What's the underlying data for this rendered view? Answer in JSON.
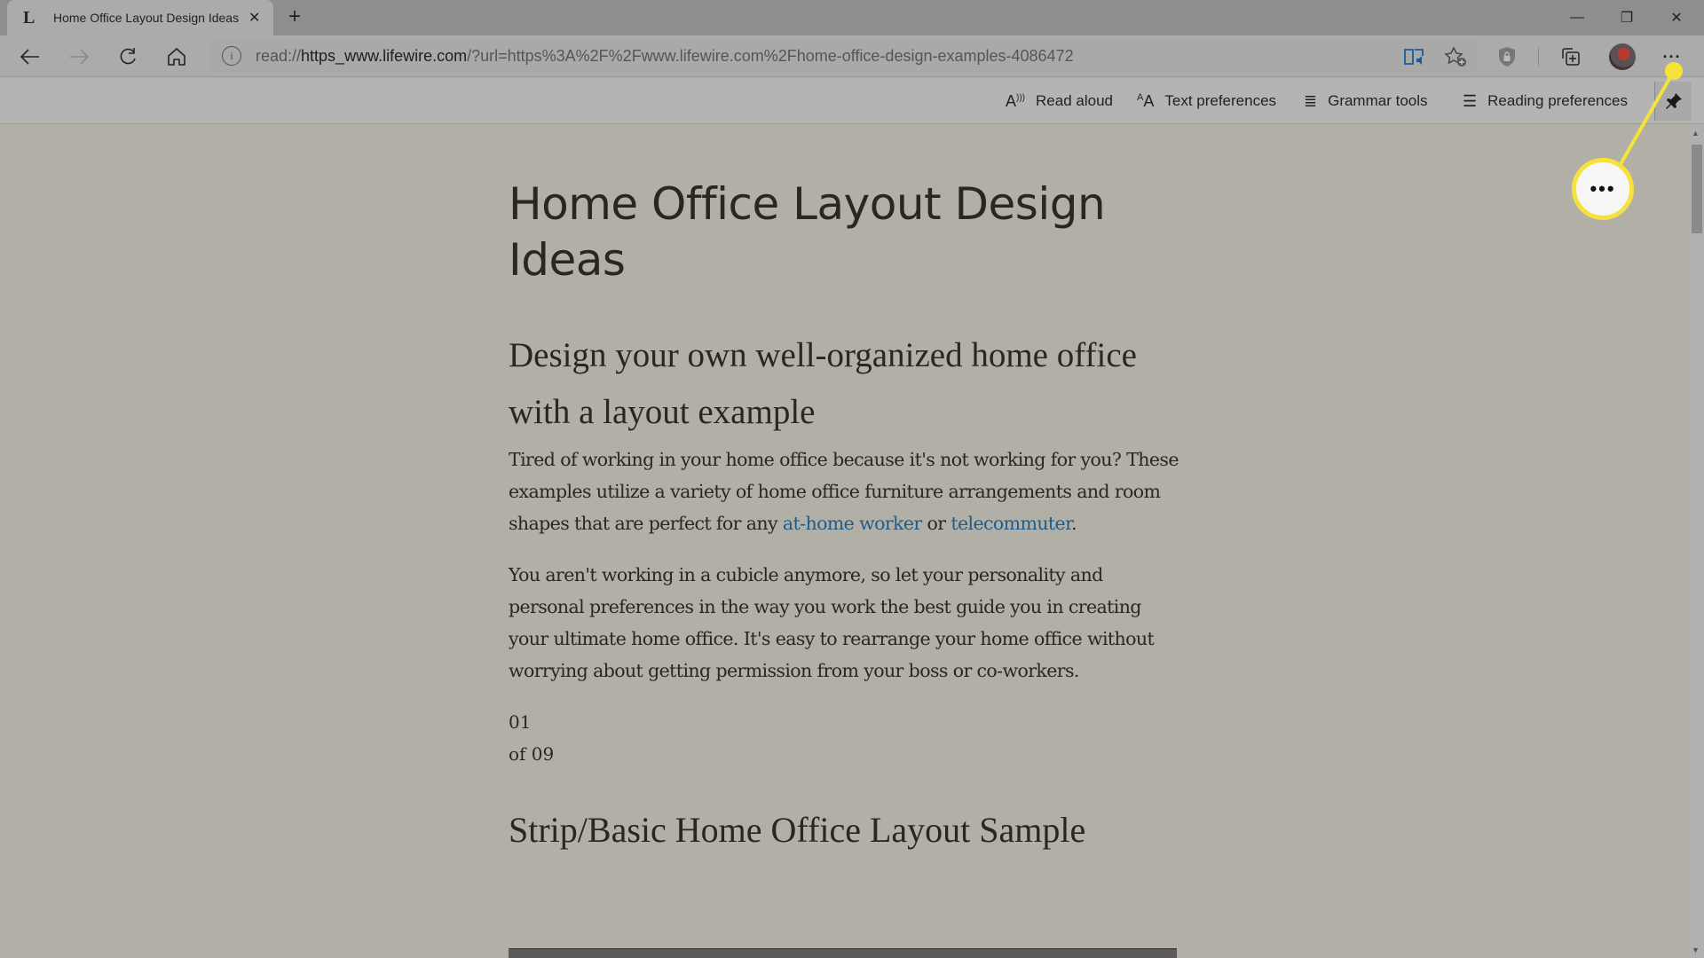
{
  "tab": {
    "favicon": "L",
    "title": "Home Office Layout Design Ideas",
    "close_icon": "close-icon"
  },
  "window_controls": {
    "minimize": "—",
    "restore": "❐",
    "close": "✕"
  },
  "address_bar": {
    "prefix": "read://",
    "host": "https_www.lifewire.com",
    "rest": "/?url=https%3A%2F%2Fwww.lifewire.com%2Fhome-office-design-examples-4086472"
  },
  "reader_toolbar": {
    "items": [
      {
        "label": "Read aloud",
        "icon": "read-aloud-icon",
        "glyph": "A⁾"
      },
      {
        "label": "Text preferences",
        "icon": "text-preferences-icon",
        "glyph": "ᴬA"
      },
      {
        "label": "Grammar tools",
        "icon": "grammar-tools-icon",
        "glyph": "≣"
      },
      {
        "label": "Reading preferences",
        "icon": "reading-preferences-icon",
        "glyph": "≡"
      }
    ]
  },
  "article": {
    "title": "Home Office Layout Design Ideas",
    "subtitle": "Design your own well-organized home office with a layout example",
    "para1_a": "Tired of working in your home office because it's not working for you? These examples utilize a variety of home office furniture arrangements and room shapes that are perfect for any ",
    "para1_link1": "at-home worker",
    "para1_b": " or ",
    "para1_link2": "telecommuter",
    "para1_c": ".",
    "para2": "You aren't working in a cubicle anymore, so let your personality and personal preferences in the way you work the best guide you in creating your ultimate home office. It's easy to rearrange your home office without worrying about getting permission from your boss or co-workers.",
    "counter_current": "01",
    "counter_total": "of 09",
    "section_heading": "Strip/Basic Home Office Layout Sample"
  },
  "callout": {
    "label": "•••",
    "color": "#f5e33c"
  },
  "colors": {
    "link": "#1f5c8a",
    "content_bg": "#b2afa7",
    "highlight": "#f5e33c"
  }
}
